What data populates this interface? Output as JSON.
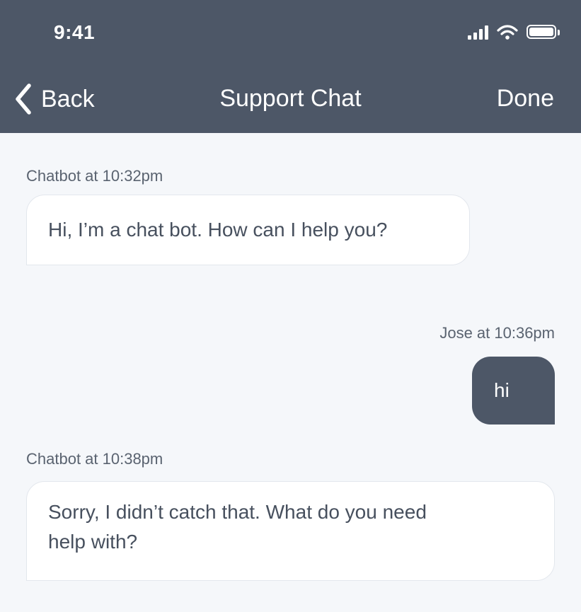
{
  "status_bar": {
    "time": "9:41",
    "icons": [
      "signal-bars-icon",
      "wifi-icon",
      "battery-icon"
    ]
  },
  "nav": {
    "back_label": "Back",
    "back_icon": "chevron-left-icon",
    "title": "Support Chat",
    "done_label": "Done"
  },
  "messages": [
    {
      "sender": "bot",
      "meta": "Chatbot at 10:32pm",
      "text": "Hi, I’m a chat bot. How can I help you?"
    },
    {
      "sender": "user",
      "meta": "Jose at 10:36pm",
      "text": "hi"
    },
    {
      "sender": "bot",
      "meta": "Chatbot at 10:38pm",
      "text_lines": [
        "Sorry, I didn’t catch that. What do you need",
        "help with?"
      ]
    }
  ],
  "colors": {
    "header_background": "#4d5767",
    "chat_background": "#f5f7fa",
    "bot_bubble_background": "#ffffff",
    "user_bubble_background": "#4d5767",
    "text_color": "#47505e"
  }
}
